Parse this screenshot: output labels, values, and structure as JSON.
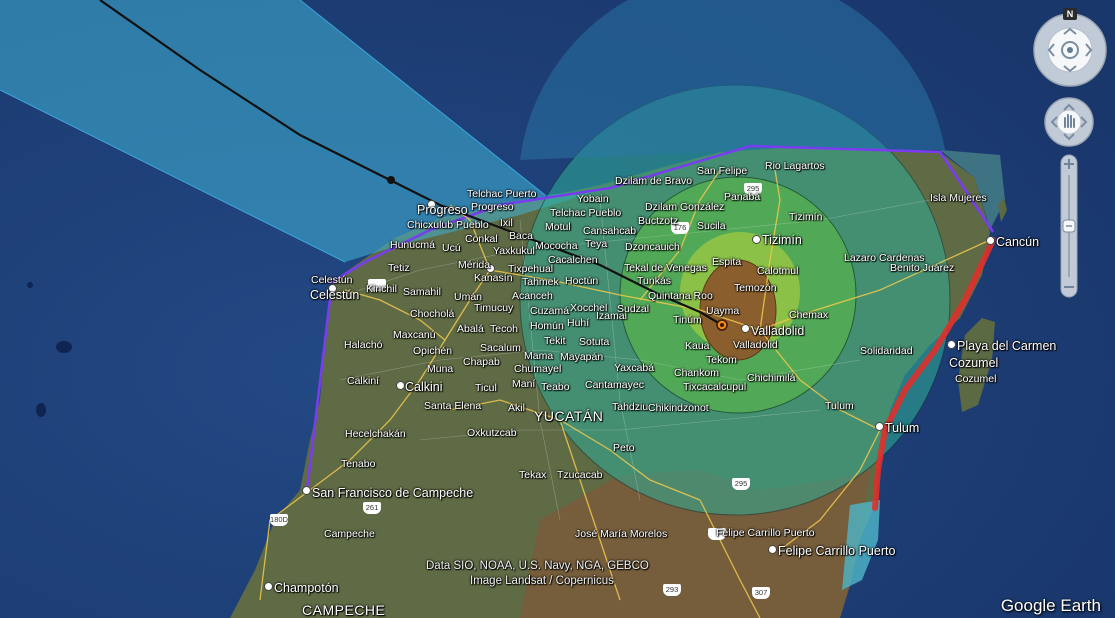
{
  "app": {
    "logo_text": "Google Earth"
  },
  "attribution": {
    "line1": "Data SIO, NOAA, U.S. Navy, NGA, GEBCO",
    "line2": "Image Landsat / Copernicus"
  },
  "compass": {
    "north_label": "N"
  },
  "labels": {
    "telchac_puerto": "Telchac Puerto",
    "progreso_small": "Progreso",
    "progreso": "Progreso",
    "dzilam": "Dzilam de Bravo",
    "san_felipe": "San Felipe",
    "rio_lagartos": "Rio Lagartos",
    "isla_mujeres": "Isla Mujeres",
    "cancun": "Cancún",
    "chicxulub": "Chicxulub Pueblo",
    "ixil": "Ixil",
    "yobain": "Yobain",
    "telchac_pueblo": "Telchac Pueblo",
    "panaba": "Panabá",
    "dzilam_gonzalez": "Dzilam González",
    "buctzotz": "Buctzotz",
    "sucila": "Sucila",
    "tizimin_small": "Tizimín",
    "tizimin": "Tizimín",
    "hunucma": "Hunucmá",
    "ucu": "Ucú",
    "conkal": "Conkal",
    "baca": "Baca",
    "motul": "Motul",
    "cansahcab": "Cansahcab",
    "teya": "Teya",
    "mococha": "Mococha",
    "yaxkukul": "Yaxkukul",
    "dzoncauich": "Dzoncauich",
    "cacalchen": "Cacalchen",
    "merida": "Mérida",
    "tetiz": "Tetiz",
    "tixpehual": "Tixpehual",
    "kanasin": "Kanasín",
    "tahmek": "Tahmek",
    "hoctun": "Hoctún",
    "tekal": "Tekal de Venegas",
    "tunkas": "Tunkás",
    "espita": "Espita",
    "calotmul": "Calotmul",
    "lazaro": "Lazaro Cardenas",
    "benito": "Benito Juárez",
    "celestun_small": "Celestún",
    "celestun": "Celestún",
    "kinchil": "Kinchil",
    "samahil": "Samahil",
    "uman": "Umán",
    "timucuy": "Timucuy",
    "acanceh": "Acanceh",
    "quintana_roo": "Quintana Roo",
    "temozon": "Temozón",
    "xocchel": "Xocchel",
    "izamal": "Izamal",
    "cuzama": "Cuzamá",
    "sudzal": "Sudzal",
    "chemax": "Chemax",
    "chochola": "Chocholá",
    "abala": "Abalá",
    "tecoh": "Tecoh",
    "homun": "Homún",
    "huhi": "Huhí",
    "uayma": "Uayma",
    "tinum": "Tinúm",
    "valladolid_small": "Valladolid",
    "valladolid": "Valladolid",
    "maxcanu": "Maxcanú",
    "tekit": "Tekit",
    "sotuta": "Sotuta",
    "kaua": "Kaua",
    "halacho": "Halachó",
    "opichen": "Opichén",
    "sacalum": "Sacalum",
    "mama": "Mama",
    "solidaridad": "Solidaridad",
    "playa": "Playa del Carmen",
    "muna": "Muna",
    "chapab": "Chapab",
    "mayapan": "Mayapán",
    "tekom": "Tekom",
    "chumayel": "Chumayel",
    "yaxcaba": "Yaxcabá",
    "chankom": "Chankom",
    "cozumel": "Cozumel",
    "cozumel_small": "Cozumel",
    "calkini_small": "Calkiní",
    "calkini": "Calkini",
    "ticul": "Ticul",
    "mani": "Maní",
    "teabo": "Teabo",
    "cantamayec": "Cantamayec",
    "tixcacalcupul": "Tixcacalcupul",
    "chichimila": "Chichimilá",
    "santa_elena": "Santa Elena",
    "akil": "Akil",
    "yucatan": "YUCATÁN",
    "tahdziu": "Tahdziu",
    "chikindzonot": "Chikindzonot",
    "tulum_small": "Tulum",
    "tulum": "Tulum",
    "hecelchakan": "Hecelchakán",
    "oxkutzcab": "Oxkutzcab",
    "peto": "Peto",
    "tenabo": "Tenabo",
    "tekax": "Tekax",
    "tzucacab": "Tzucacab",
    "campeche_city": "San Francisco de Campeche",
    "jose_maria": "José María Morelos",
    "felipe_small": "Felipe Carrillo Puerto",
    "felipe": "Felipe Carrillo Puerto",
    "campeche": "Campeche",
    "champoton": "Champotón",
    "campeche_state": "CAMPECHE"
  },
  "shields": {
    "s295a": "295",
    "s176": "176",
    "s295b": "295",
    "s180d": "180D",
    "s261": "261",
    "s293": "293",
    "s307": "307"
  },
  "colors": {
    "ocean": "#1d3f7a",
    "cone": "#3fb3d6",
    "outer_wind": "#2fae97",
    "mid_wind": "#59b84a",
    "inner_wind": "#b0d23a",
    "core": "#8a5a2c",
    "warning_line": "#7a3cf0",
    "red_warning": "#e0302a",
    "track": "#111111"
  }
}
